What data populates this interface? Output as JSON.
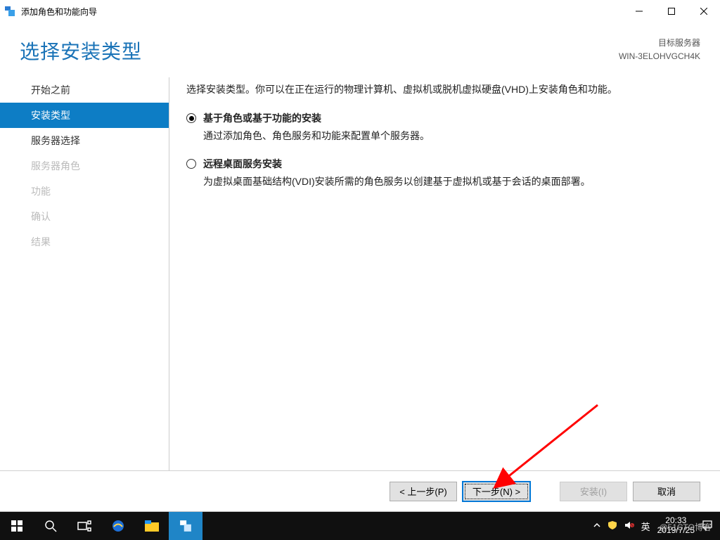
{
  "window": {
    "title": "添加角色和功能向导"
  },
  "header": {
    "pageTitle": "选择安装类型",
    "targetLabel": "目标服务器",
    "targetServer": "WIN-3ELOHVGCH4K"
  },
  "sidebar": {
    "items": [
      {
        "label": "开始之前",
        "state": "normal"
      },
      {
        "label": "安装类型",
        "state": "selected"
      },
      {
        "label": "服务器选择",
        "state": "normal"
      },
      {
        "label": "服务器角色",
        "state": "disabled"
      },
      {
        "label": "功能",
        "state": "disabled"
      },
      {
        "label": "确认",
        "state": "disabled"
      },
      {
        "label": "结果",
        "state": "disabled"
      }
    ]
  },
  "content": {
    "intro": "选择安装类型。你可以在正在运行的物理计算机、虚拟机或脱机虚拟硬盘(VHD)上安装角色和功能。",
    "options": [
      {
        "title": "基于角色或基于功能的安装",
        "desc": "通过添加角色、角色服务和功能来配置单个服务器。",
        "checked": true
      },
      {
        "title": "远程桌面服务安装",
        "desc": "为虚拟桌面基础结构(VDI)安装所需的角色服务以创建基于虚拟机或基于会话的桌面部署。",
        "checked": false
      }
    ]
  },
  "footer": {
    "prev": "< 上一步(P)",
    "next": "下一步(N) >",
    "install": "安装(I)",
    "cancel": "取消"
  },
  "taskbar": {
    "ime": "英",
    "time": "20:33",
    "date": "2019/7/25"
  },
  "watermark": "@51CTO博客"
}
